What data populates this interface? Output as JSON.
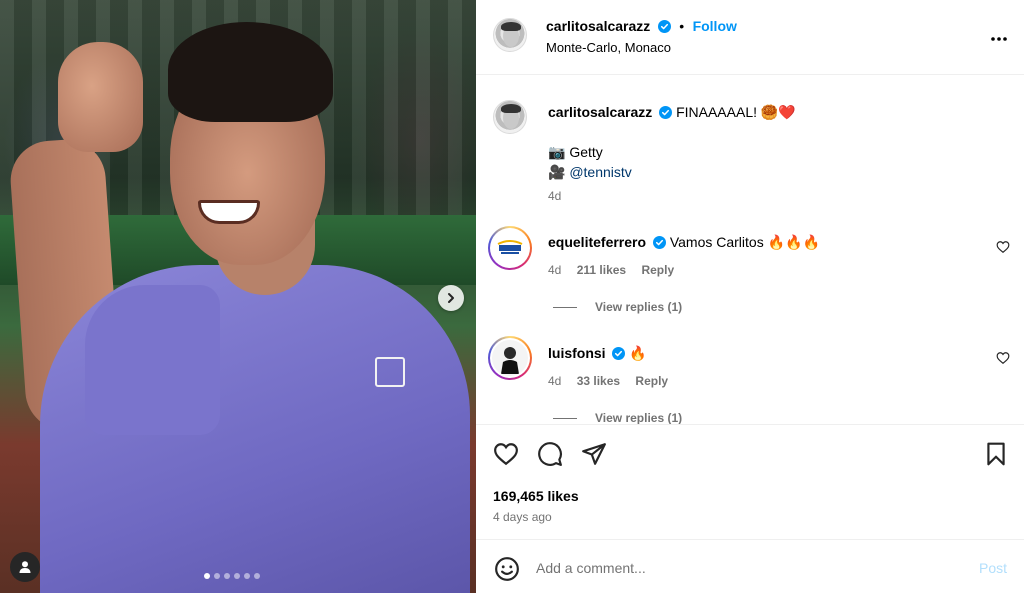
{
  "post": {
    "author": "carlitosalcarazz",
    "follow_label": "Follow",
    "separator": "•",
    "location": "Monte-Carlo, Monaco",
    "more_icon": "more-horizontal-icon",
    "image": {
      "slide_count": 6,
      "active_slide": 1
    }
  },
  "caption": {
    "author": "carlitosalcarazz",
    "text": "FINAAAAAL! 🥮❤️",
    "credit_photo_prefix": "📷 ",
    "credit_photo": "Getty",
    "credit_video_prefix": "🎥 ",
    "credit_video": "@tennistv",
    "time": "4d"
  },
  "comments": [
    {
      "author": "equeliteferrero",
      "verified": true,
      "text": "Vamos Carlitos 🔥🔥🔥",
      "time": "4d",
      "likes": "211 likes",
      "reply_label": "Reply",
      "view_replies": "View replies (1)"
    },
    {
      "author": "luisfonsi",
      "verified": true,
      "text": "🔥",
      "time": "4d",
      "likes": "33 likes",
      "reply_label": "Reply",
      "view_replies": "View replies (1)"
    }
  ],
  "stats": {
    "likes": "169,465 likes",
    "posted": "4 days ago"
  },
  "composer": {
    "placeholder": "Add a comment...",
    "post_label": "Post"
  },
  "colors": {
    "accent": "#0095f6",
    "verified": "#0095f6",
    "secondary_text": "#737373",
    "post_disabled": "#b2dffc"
  }
}
